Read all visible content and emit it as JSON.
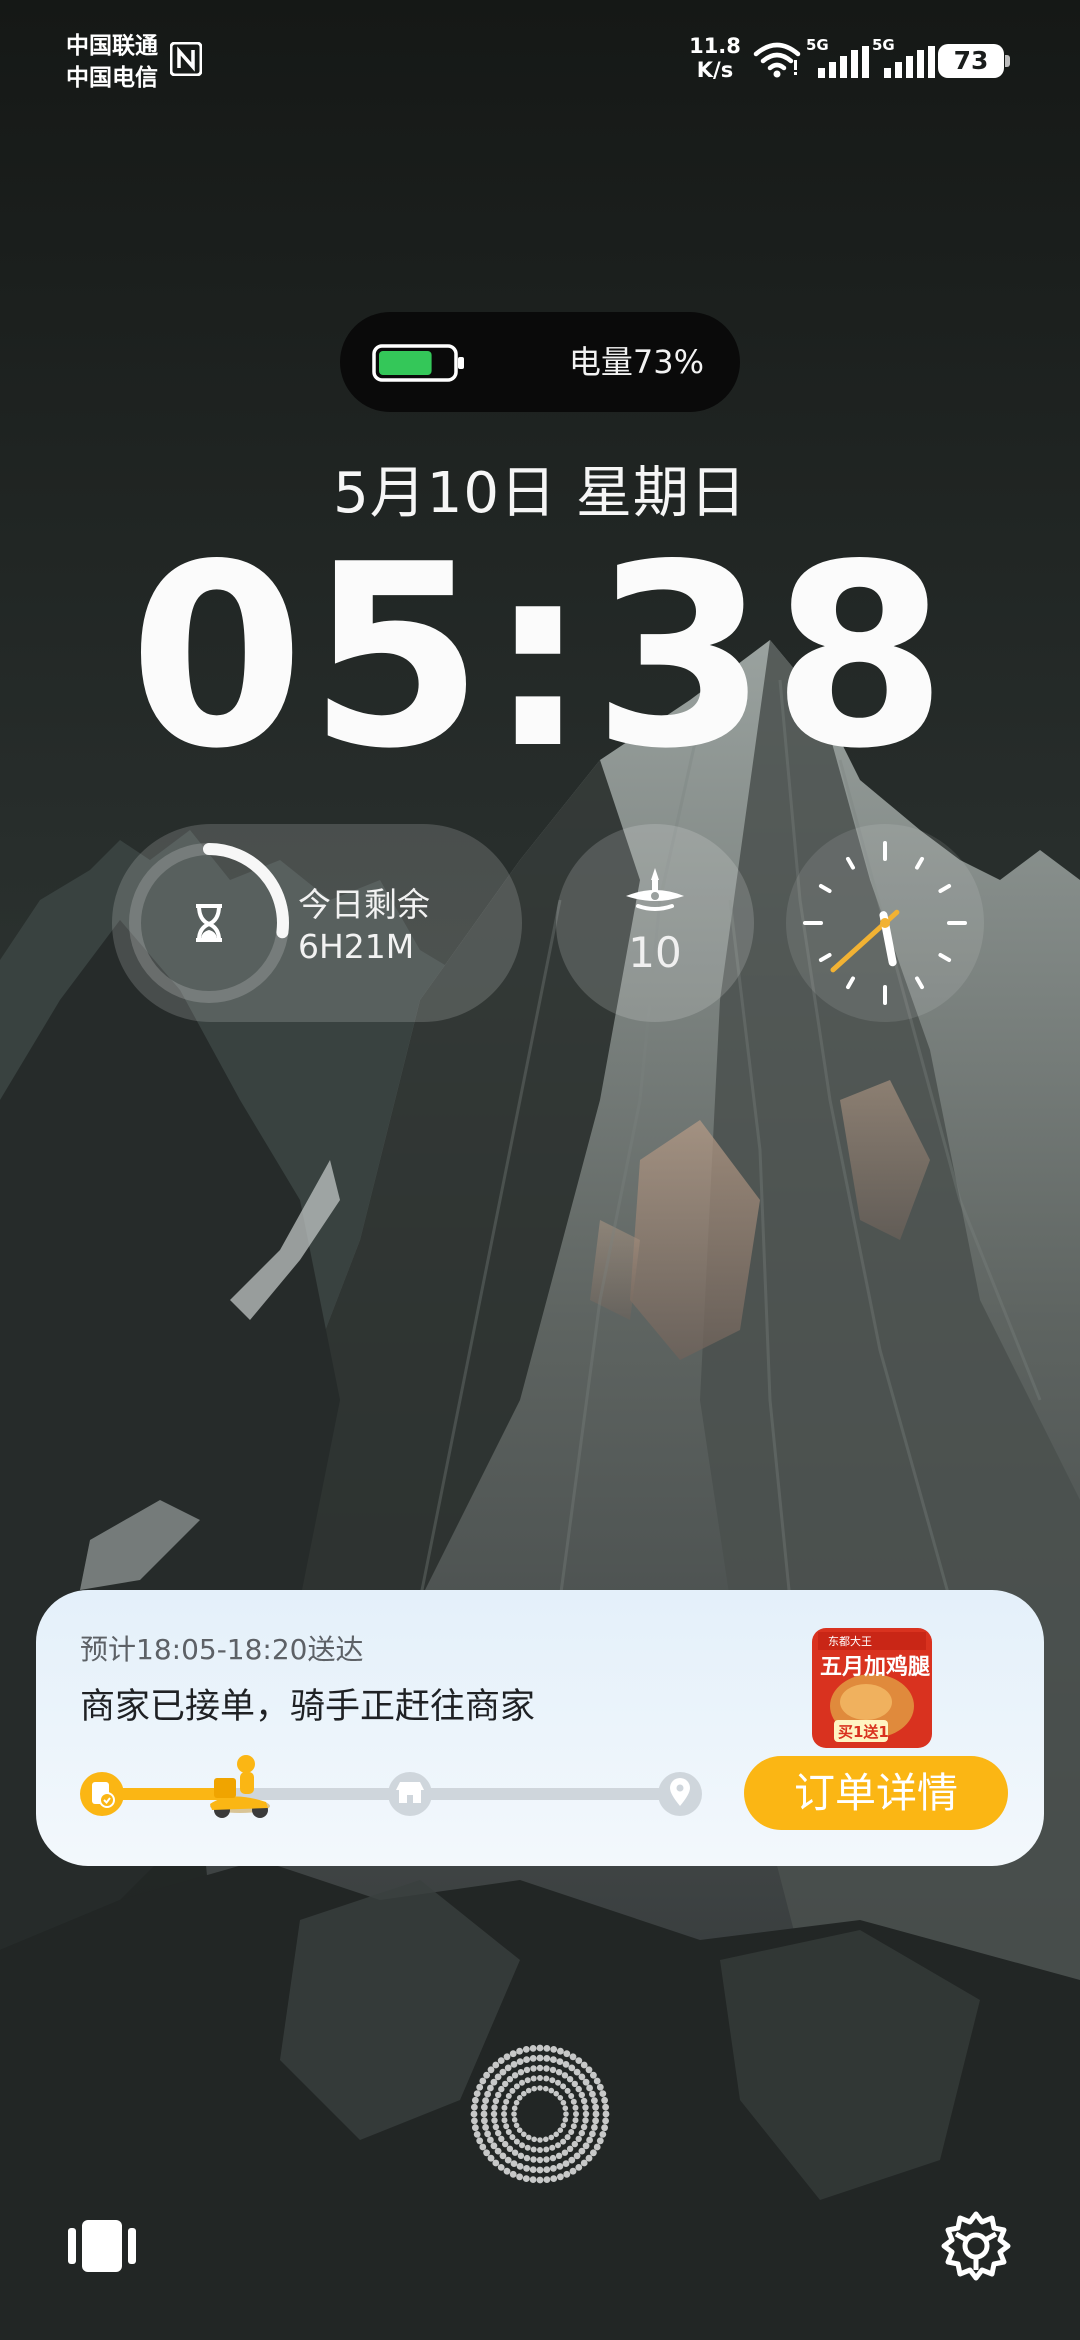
{
  "status_bar": {
    "carrier_1": "中国联通",
    "carrier_2": "中国电信",
    "net_speed_value": "11.8",
    "net_speed_unit": "K/s",
    "sim1_tag": "5G",
    "sim2_tag": "5G",
    "battery_level": "73",
    "icons": [
      "nfc-icon",
      "wifi-icon",
      "signal-icon",
      "battery-icon"
    ]
  },
  "battery_pill": {
    "text": "电量73%",
    "level_percent": 73,
    "icon": "battery-icon",
    "fill_color": "#34c759"
  },
  "lockscreen": {
    "date": "5月10日 星期日",
    "time": "05:38"
  },
  "widgets": {
    "day_remaining": {
      "title": "今日剩余",
      "value": "6H21M",
      "icon": "hourglass-icon",
      "progress_fraction": 0.27
    },
    "wind": {
      "value": "10",
      "icon": "wind-icon"
    },
    "analog_clock": {
      "icon": "analog-clock-icon",
      "hour_hand": "05:38",
      "accent_color": "#f2b233"
    }
  },
  "delivery_card": {
    "eta": "预计18:05-18:20送达",
    "status": "商家已接单，骑手正赶往商家",
    "button_label": "订单详情",
    "progress_fraction": 0.22,
    "stages": [
      "order-icon",
      "rider-icon",
      "shop-icon",
      "location-pin-icon"
    ],
    "thumbnail": {
      "brand": "东都大王",
      "headline": "五月加鸡腿",
      "promo": "买1送1"
    },
    "accent_color": "#fbb614",
    "track_color": "#cfd6dc"
  },
  "bottom": {
    "icons": [
      "fingerprint-icon",
      "wallet-icon",
      "settings-icon"
    ]
  }
}
